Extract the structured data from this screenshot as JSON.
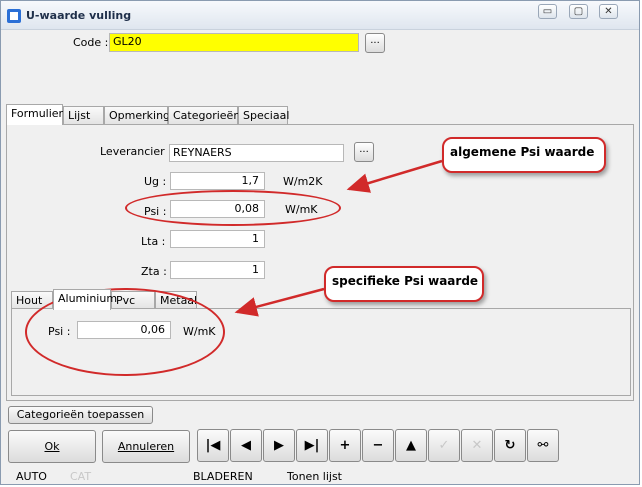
{
  "window": {
    "title": "U-waarde vulling",
    "min_glyph": "▭",
    "max_glyph": "▢",
    "close_glyph": "✕"
  },
  "code": {
    "label": "Code :",
    "value": "GL20",
    "browse": "..."
  },
  "tabs": [
    "Formulier",
    "Lijst",
    "Opmerking",
    "Categorieën",
    "Speciaal"
  ],
  "form": {
    "leverancier": {
      "label": "Leverancier :",
      "value": "REYNAERS",
      "browse": "..."
    },
    "ug": {
      "label": "Ug :",
      "value": "1,7",
      "unit": "W/m2K"
    },
    "psi": {
      "label": "Psi :",
      "value": "0,08",
      "unit": "W/mK"
    },
    "lta": {
      "label": "Lta :",
      "value": "1"
    },
    "zta": {
      "label": "Zta :",
      "value": "1"
    }
  },
  "subtabs": [
    "Hout",
    "Aluminium",
    "Pvc",
    "Metaal"
  ],
  "subform": {
    "psi": {
      "label": "Psi :",
      "value": "0,06",
      "unit": "W/mK"
    }
  },
  "callouts": {
    "general": "algemene Psi waarde",
    "specific": "specifieke Psi waarde"
  },
  "buttons": {
    "apply": "Categorieën toepassen",
    "ok": "Ok",
    "cancel": "Annuleren"
  },
  "nav": {
    "first": "|◀",
    "prev": "◀",
    "next": "▶",
    "last": "▶|",
    "add": "+",
    "remove": "−",
    "up": "▲",
    "confirm": "✓",
    "discard": "✕",
    "refresh": "↻",
    "search": "⚯"
  },
  "status": {
    "mode": "AUTO",
    "cat": "CAT",
    "state": "BLADEREN",
    "list": "Tonen lijst"
  },
  "colors": {
    "code_field": "#ffff00",
    "callout_border": "#d12a2a"
  }
}
